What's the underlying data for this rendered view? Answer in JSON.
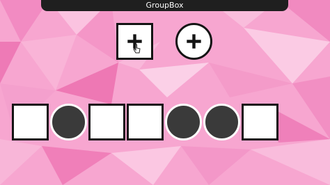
{
  "window": {
    "title": "GroupBox"
  },
  "tools": [
    {
      "shape": "square",
      "icon": "plus-icon"
    },
    {
      "shape": "circle",
      "icon": "plus-icon"
    }
  ],
  "slots": [
    "square",
    "circle",
    "square",
    "square",
    "circle",
    "circle",
    "square"
  ],
  "colors": {
    "background": "#f7a6d0",
    "square_fill": "#ffffff",
    "circle_fill": "#3a3a3a",
    "outline": "#141414",
    "titlebar": "#1f1f1f"
  }
}
